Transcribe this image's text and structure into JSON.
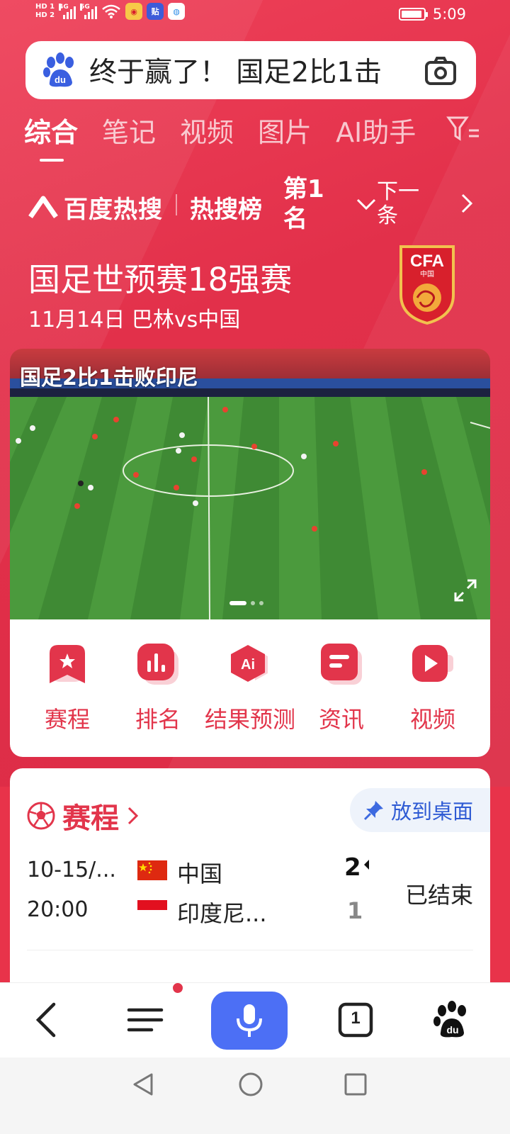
{
  "status_bar": {
    "hd1": "HD 1",
    "hd2": "HD 2",
    "net1": "4G",
    "net2": "5G",
    "time": "5:09",
    "app_icons": [
      "weibo-icon",
      "tieba-icon",
      "browser-icon"
    ]
  },
  "search": {
    "query": "终于赢了！ 国足2比1击",
    "icons": [
      "baidu-paw-icon",
      "camera-icon"
    ]
  },
  "tabs": [
    "综合",
    "笔记",
    "视频",
    "图片",
    "AI助手"
  ],
  "hot": {
    "brand": "百度热搜",
    "list": "热搜榜",
    "rank": "第1名",
    "next": "下一条"
  },
  "event": {
    "title": "国足世预赛18强赛",
    "subtitle": "11月14日 巴林vs中国"
  },
  "video": {
    "overlay_title": "国足2比1击败印尼"
  },
  "quick_actions": [
    {
      "label": "赛程",
      "icon": "star-bookmark-icon"
    },
    {
      "label": "排名",
      "icon": "bar-chart-icon"
    },
    {
      "label": "结果预测",
      "icon": "ai-icon"
    },
    {
      "label": "资讯",
      "icon": "news-icon"
    },
    {
      "label": "视频",
      "icon": "play-video-icon"
    }
  ],
  "schedule": {
    "title": "赛程",
    "pin_label": "放到桌面",
    "match": {
      "date": "10-15/...",
      "time": "20:00",
      "team1": "中国",
      "team2": "印度尼...",
      "score1": "2",
      "score2": "1",
      "status": "已结束"
    }
  },
  "toolbar": {
    "tabs_count": "1"
  },
  "colors": {
    "brand_red": "#e2354b",
    "mic_blue": "#4c6ff5",
    "pin_blue": "#2f5bd4"
  }
}
